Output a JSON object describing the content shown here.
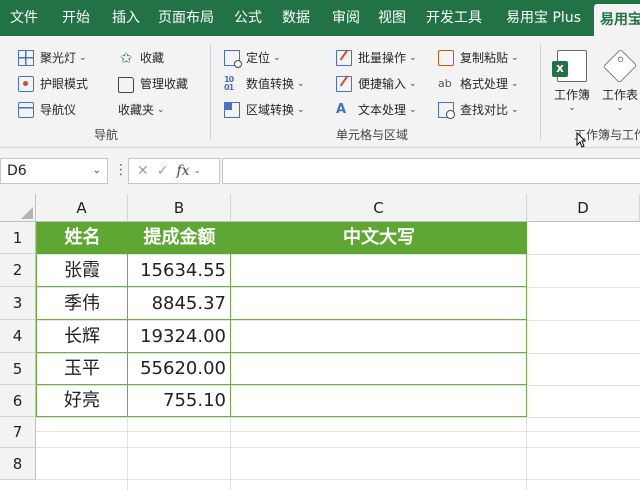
{
  "tabs": [
    {
      "label": "文件"
    },
    {
      "label": "开始"
    },
    {
      "label": "插入"
    },
    {
      "label": "页面布局"
    },
    {
      "label": "公式"
    },
    {
      "label": "数据"
    },
    {
      "label": "审阅"
    },
    {
      "label": "视图"
    },
    {
      "label": "开发工具"
    },
    {
      "label": "易用宝 Plus"
    },
    {
      "label": "易用宝"
    }
  ],
  "ribbon": {
    "nav_group": {
      "label": "导航",
      "items": [
        "聚光灯",
        "护眼模式",
        "导航仪",
        "收藏",
        "管理收藏",
        "收藏夹"
      ]
    },
    "cell_group": {
      "label": "单元格与区域",
      "items": [
        "定位",
        "数值转换",
        "区域转换",
        "批量操作",
        "便捷输入",
        "文本处理",
        "复制粘贴",
        "格式处理",
        "查找对比"
      ]
    },
    "wb_group": {
      "label": "工作簿与工作",
      "items": [
        "工作簿",
        "工作表"
      ]
    }
  },
  "formula_bar": {
    "name_box": "D6",
    "fx_label": "fx",
    "formula": ""
  },
  "sheet": {
    "columns": [
      "A",
      "B",
      "C",
      "D"
    ],
    "rows": [
      "1",
      "2",
      "3",
      "4",
      "5",
      "6",
      "7",
      "8"
    ],
    "header_row": [
      "姓名",
      "提成金额",
      "中文大写"
    ],
    "data": [
      {
        "name": "张霞",
        "amount": "15634.55",
        "upper": ""
      },
      {
        "name": "季伟",
        "amount": "8845.37",
        "upper": ""
      },
      {
        "name": "长辉",
        "amount": "19324.00",
        "upper": ""
      },
      {
        "name": "玉平",
        "amount": "55620.00",
        "upper": ""
      },
      {
        "name": "好亮",
        "amount": "755.10",
        "upper": ""
      }
    ]
  },
  "colors": {
    "ribbon_tab_bar": "#217346",
    "table_header_fill": "#5fa733",
    "table_border": "#70ad47"
  }
}
